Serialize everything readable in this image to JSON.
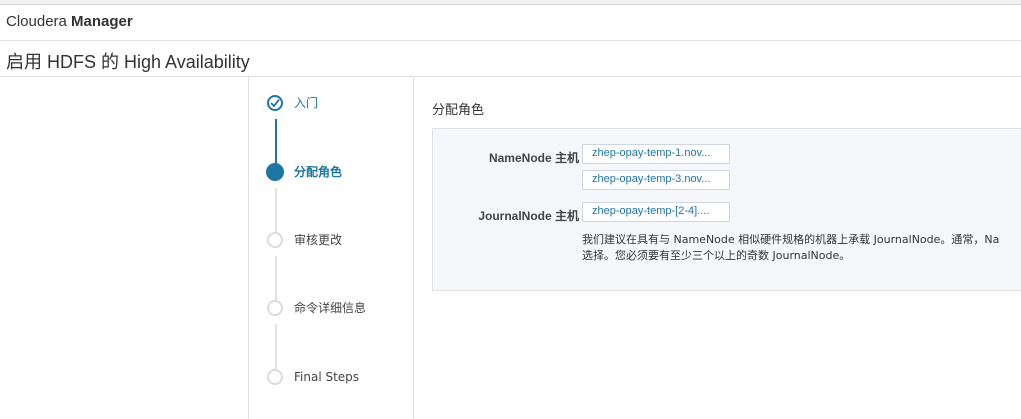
{
  "brand": {
    "part1": "Cloudera",
    "part2": "Manager"
  },
  "page": {
    "title": "启用 HDFS 的 High Availability"
  },
  "steps": [
    {
      "label": "入门",
      "state": "done"
    },
    {
      "label": "分配角色",
      "state": "active"
    },
    {
      "label": "审核更改",
      "state": "pending"
    },
    {
      "label": "命令详细信息",
      "state": "pending"
    },
    {
      "label": "Final Steps",
      "state": "pending"
    }
  ],
  "assign": {
    "title": "分配角色",
    "namenode_label": "NameNode 主机",
    "namenode_hosts": [
      "zhep-opay-temp-1.nov...",
      "zhep-opay-temp-3.nov..."
    ],
    "journalnode_label": "JournalNode 主机",
    "journalnode_host": "zhep-opay-temp-[2-4]....",
    "hint_line1": "我们建议在具有与 NameNode 相似硬件规格的机器上承载 JournalNode。通常，Na",
    "hint_line2": "选择。您必须要有至少三个以上的奇数 JournalNode。"
  },
  "colors": {
    "accent": "#1d76a3",
    "border": "#e2e2e2",
    "panel_bg": "#f5f7fa"
  }
}
